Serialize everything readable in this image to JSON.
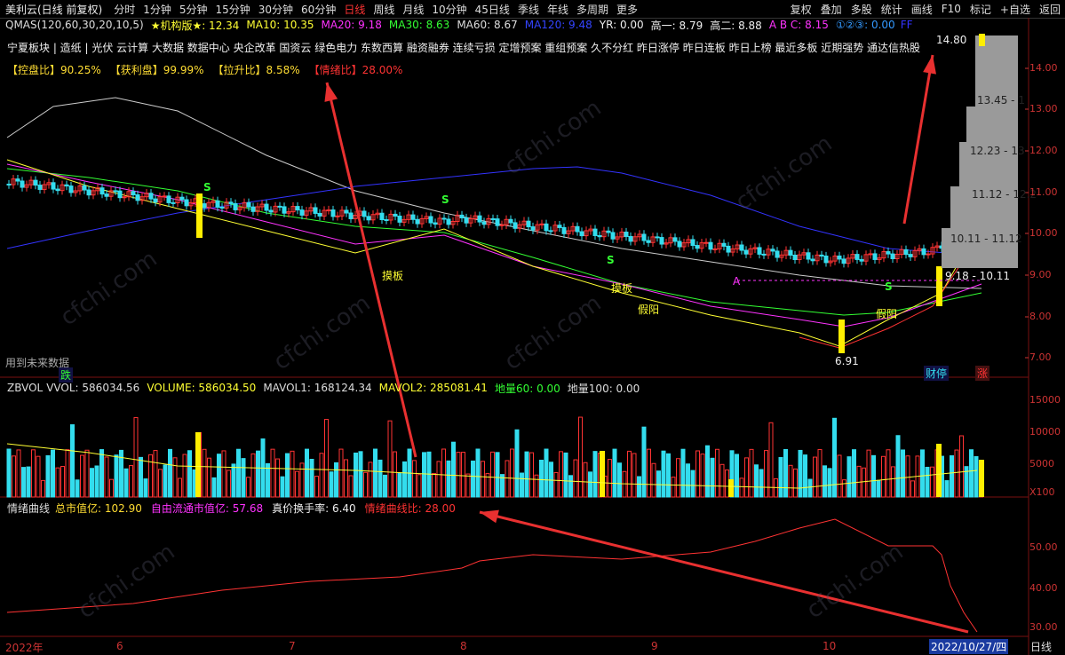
{
  "toolbar": {
    "title": "美利云(日线 前复权)",
    "periods": [
      "分时",
      "1分钟",
      "5分钟",
      "15分钟",
      "30分钟",
      "60分钟",
      "日线",
      "周线",
      "月线",
      "10分钟",
      "45日线",
      "季线",
      "年线",
      "多周期",
      "更多"
    ],
    "active_period": "日线",
    "right_buttons": [
      "复权",
      "叠加",
      "多股",
      "统计",
      "画线",
      "F10",
      "标记",
      "+自选",
      "返回"
    ]
  },
  "indicator_line": {
    "qmas": "QMAS(120,60,30,20,10,5)",
    "jigou": "★机构版★: 12.34",
    "ma10": "MA10: 10.35",
    "ma20": "MA20: 9.18",
    "ma30": "MA30: 8.63",
    "ma60": "MA60: 8.67",
    "ma120": "MA120: 9.48",
    "yr": "YR: 0.00",
    "gao1": "高一: 8.79",
    "gao2": "高二: 8.88",
    "abc": "A B C: 8.15",
    "circles": "①②③: 0.00",
    "ff": "FF"
  },
  "concepts": "宁夏板块 | 造纸 | 光伏  云计算  大数据  数据中心  央企改革  国资云  绿色电力  东数西算  融资融券  连续亏损  定增预案  重组预案  久不分红  昨日涨停  昨日连板  昨日上榜  最近多板  近期强势  通达信热股",
  "stats": {
    "kongpan": "【控盘比】90.25%",
    "huoli": "【获利盘】99.99%",
    "lasheng": "【拉升比】8.58%",
    "qingxu": "【情绪比】28.00%"
  },
  "price_axis": [
    "14.00",
    "13.00",
    "12.00",
    "11.00",
    "10.00",
    "9.00",
    "8.00",
    "7.00"
  ],
  "vol_axis": [
    "15000",
    "10000",
    "5000",
    "X100"
  ],
  "sent_axis": [
    "50.00",
    "40.00",
    "30.00"
  ],
  "profile_labels": [
    "14.80",
    "13.45 - 1",
    "12.23 - 13",
    "11.12 - 12.2",
    "10.11 - 11.12",
    "9.18 - 10.11"
  ],
  "chart_labels": {
    "low": "6.91",
    "future": "用到未来数据",
    "die": "跌",
    "caiting": "财停",
    "zhang": "涨",
    "moban1": "摸板",
    "moban2": "摸板",
    "jiayang1": "假阳",
    "jiayang2": "假阳",
    "point_a": "A",
    "s": "S"
  },
  "vol_line": {
    "name": "ZBVOL",
    "vvol": "VVOL: 586034.56",
    "volume": "VOLUME: 586034.50",
    "mavol1": "MAVOL1: 168124.34",
    "mavol2": "MAVOL2: 285081.41",
    "diliang60": "地量60: 0.00",
    "diliang100": "地量100: 0.00"
  },
  "sent_line": {
    "name": "情绪曲线",
    "total": "总市值亿: 102.90",
    "free": "自由流通市值亿: 57.68",
    "turnover": "真价换手率: 6.40",
    "ratio": "情绪曲线比: 28.00"
  },
  "xaxis": {
    "months": [
      "2022年",
      "6",
      "7",
      "8",
      "9",
      "10"
    ],
    "date": "2022/10/27/四",
    "tab": "日线"
  },
  "colors": {
    "up": "#ff3333",
    "down": "#33ddee",
    "ma5": "#ffffff",
    "ma10": "#ffff33",
    "ma20": "#ff33ff",
    "ma30": "#33ff33",
    "ma60": "#cccccc",
    "ma120": "#3333ff"
  }
}
